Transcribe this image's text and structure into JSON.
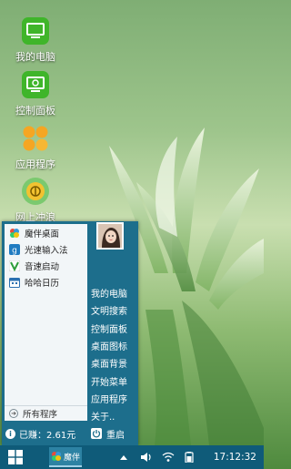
{
  "desktop": {
    "icons": [
      {
        "label": "我的电脑",
        "icon": "computer-icon"
      },
      {
        "label": "控制面板",
        "icon": "control-panel-icon"
      },
      {
        "label": "应用程序",
        "icon": "apps-icon"
      },
      {
        "label": "网上冲浪",
        "icon": "browser-icon"
      }
    ]
  },
  "start_menu": {
    "apps": [
      {
        "label": "魔伴桌面",
        "icon": "mobanzhuomian-icon"
      },
      {
        "label": "光速输入法",
        "icon": "input-method-icon"
      },
      {
        "label": "音速启动",
        "icon": "vstart-icon"
      },
      {
        "label": "哈哈日历",
        "icon": "calendar-icon"
      }
    ],
    "all_programs": "所有程序",
    "earnings": "已赚：2.61元",
    "right_items": [
      "我的电脑",
      "文明搜索",
      "控制面板",
      "桌面图标",
      "桌面背景",
      "开始菜单",
      "应用程序",
      "关于.."
    ],
    "restart": "重启"
  },
  "taskbar": {
    "running_app": "魔伴",
    "clock": "17:12:32"
  },
  "colors": {
    "menu_blue": "#1d6e8c",
    "taskbar_blue": "#0f5b79",
    "icon_green": "#3fb52a"
  }
}
